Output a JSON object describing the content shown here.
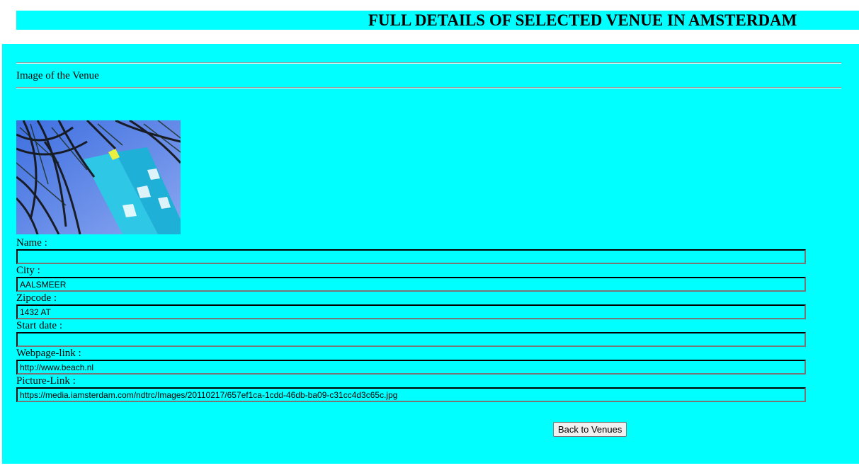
{
  "header": {
    "title": "FULL DETAILS OF SELECTED VENUE IN AMSTERDAM"
  },
  "section": {
    "heading": "Image of the Venue"
  },
  "fields": [
    {
      "label": "Name :",
      "value": ""
    },
    {
      "label": "City :",
      "value": "AALSMEER"
    },
    {
      "label": "Zipcode :",
      "value": "1432 AT"
    },
    {
      "label": "Start date :",
      "value": ""
    },
    {
      "label": "Webpage-link :",
      "value": "http://www.beach.nl"
    },
    {
      "label": "Picture-Link :",
      "value": "https://media.iamsterdam.com/ndtrc/Images/20110217/657ef1ca-1cdd-46db-ba09-c31cc4d3c65c.jpg"
    }
  ],
  "actions": {
    "back_label": "Back to Venues"
  },
  "colors": {
    "page_background": "#00ffff",
    "body_background": "#ffffff"
  }
}
